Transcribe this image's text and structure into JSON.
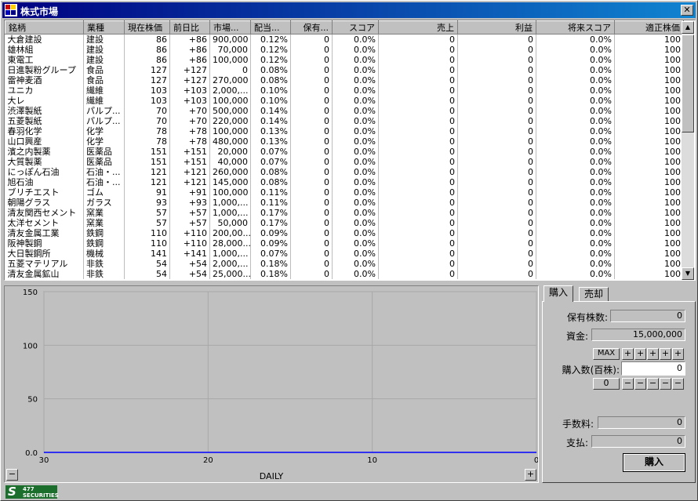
{
  "window": {
    "title": "株式市場",
    "close_label": "✕"
  },
  "table": {
    "columns": [
      "銘柄",
      "業種",
      "現在株価",
      "前日比",
      "市場...",
      "配当...",
      "保有...",
      "スコア",
      "売上",
      "利益",
      "将来スコア",
      "適正株価"
    ],
    "rows": [
      [
        "大倉建設",
        "建設",
        "86",
        "+86",
        "900,000",
        "0.12%",
        "0",
        "0.0%",
        "0",
        "0",
        "0.0%",
        "100"
      ],
      [
        "雄林組",
        "建設",
        "86",
        "+86",
        "70,000",
        "0.12%",
        "0",
        "0.0%",
        "0",
        "0",
        "0.0%",
        "100"
      ],
      [
        "東電工",
        "建設",
        "86",
        "+86",
        "100,000",
        "0.12%",
        "0",
        "0.0%",
        "0",
        "0",
        "0.0%",
        "100"
      ],
      [
        "日進製粉グループ",
        "食品",
        "127",
        "+127",
        "0",
        "0.08%",
        "0",
        "0.0%",
        "0",
        "0",
        "0.0%",
        "100"
      ],
      [
        "雷神麦酒",
        "食品",
        "127",
        "+127",
        "270,000",
        "0.08%",
        "0",
        "0.0%",
        "0",
        "0",
        "0.0%",
        "100"
      ],
      [
        "ユニカ",
        "繊維",
        "103",
        "+103",
        "2,000,...",
        "0.10%",
        "0",
        "0.0%",
        "0",
        "0",
        "0.0%",
        "100"
      ],
      [
        "大レ",
        "繊維",
        "103",
        "+103",
        "100,000",
        "0.10%",
        "0",
        "0.0%",
        "0",
        "0",
        "0.0%",
        "100"
      ],
      [
        "渋澤製紙",
        "パルプ...",
        "70",
        "+70",
        "500,000",
        "0.14%",
        "0",
        "0.0%",
        "0",
        "0",
        "0.0%",
        "100"
      ],
      [
        "五菱製紙",
        "パルプ...",
        "70",
        "+70",
        "220,000",
        "0.14%",
        "0",
        "0.0%",
        "0",
        "0",
        "0.0%",
        "100"
      ],
      [
        "春羽化学",
        "化学",
        "78",
        "+78",
        "100,000",
        "0.13%",
        "0",
        "0.0%",
        "0",
        "0",
        "0.0%",
        "100"
      ],
      [
        "山口興産",
        "化学",
        "78",
        "+78",
        "480,000",
        "0.13%",
        "0",
        "0.0%",
        "0",
        "0",
        "0.0%",
        "100"
      ],
      [
        "濱之内製薬",
        "医薬品",
        "151",
        "+151",
        "20,000",
        "0.07%",
        "0",
        "0.0%",
        "0",
        "0",
        "0.0%",
        "100"
      ],
      [
        "大質製薬",
        "医薬品",
        "151",
        "+151",
        "40,000",
        "0.07%",
        "0",
        "0.0%",
        "0",
        "0",
        "0.0%",
        "100"
      ],
      [
        "にっぽん石油",
        "石油・...",
        "121",
        "+121",
        "260,000",
        "0.08%",
        "0",
        "0.0%",
        "0",
        "0",
        "0.0%",
        "100"
      ],
      [
        "旭石油",
        "石油・...",
        "121",
        "+121",
        "145,000",
        "0.08%",
        "0",
        "0.0%",
        "0",
        "0",
        "0.0%",
        "100"
      ],
      [
        "ブリチエスト",
        "ゴム",
        "91",
        "+91",
        "100,000",
        "0.11%",
        "0",
        "0.0%",
        "0",
        "0",
        "0.0%",
        "100"
      ],
      [
        "朝陽グラス",
        "ガラス",
        "93",
        "+93",
        "1,000,...",
        "0.11%",
        "0",
        "0.0%",
        "0",
        "0",
        "0.0%",
        "100"
      ],
      [
        "清友関西セメント",
        "窯業",
        "57",
        "+57",
        "1,000,...",
        "0.17%",
        "0",
        "0.0%",
        "0",
        "0",
        "0.0%",
        "100"
      ],
      [
        "太洋セメント",
        "窯業",
        "57",
        "+57",
        "50,000",
        "0.17%",
        "0",
        "0.0%",
        "0",
        "0",
        "0.0%",
        "100"
      ],
      [
        "清友金属工業",
        "鉄鋼",
        "110",
        "+110",
        "200,00...",
        "0.09%",
        "0",
        "0.0%",
        "0",
        "0",
        "0.0%",
        "100"
      ],
      [
        "阪神製鋼",
        "鉄鋼",
        "110",
        "+110",
        "28,000...",
        "0.09%",
        "0",
        "0.0%",
        "0",
        "0",
        "0.0%",
        "100"
      ],
      [
        "大日製鋼所",
        "機械",
        "141",
        "+141",
        "1,000,...",
        "0.07%",
        "0",
        "0.0%",
        "0",
        "0",
        "0.0%",
        "100"
      ],
      [
        "五菱マテリアル",
        "非鉄",
        "54",
        "+54",
        "2,000,...",
        "0.18%",
        "0",
        "0.0%",
        "0",
        "0",
        "0.0%",
        "100"
      ],
      [
        "清友金属鉱山",
        "非鉄",
        "54",
        "+54",
        "25,000...",
        "0.18%",
        "0",
        "0.0%",
        "0",
        "0",
        "0.0%",
        "100"
      ]
    ]
  },
  "chart": {
    "period_label": "DAILY",
    "zoom_out_label": "−",
    "zoom_in_label": "+",
    "line_color": "#0000ff"
  },
  "chart_data": {
    "type": "line",
    "x": [
      30,
      29,
      28,
      27,
      26,
      25,
      24,
      23,
      22,
      21,
      20,
      19,
      18,
      17,
      16,
      15,
      14,
      13,
      12,
      11,
      10,
      9,
      8,
      7,
      6,
      5,
      4,
      3,
      2,
      1,
      0
    ],
    "series": [
      {
        "values": [
          0,
          0,
          0,
          0,
          0,
          0,
          0,
          0,
          0,
          0,
          0,
          0,
          0,
          0,
          0,
          0,
          0,
          0,
          0,
          0,
          0,
          0,
          0,
          0,
          0,
          0,
          0,
          0,
          0,
          0,
          0
        ]
      }
    ],
    "xlim": [
      30,
      0
    ],
    "ylim": [
      0,
      150
    ],
    "x_ticks": [
      "30",
      "20",
      "10",
      "0"
    ],
    "y_ticks": [
      "150",
      "100",
      "50",
      "0.0"
    ],
    "grid": true
  },
  "trade": {
    "tabs": [
      "購入",
      "売却"
    ],
    "holdings_label": "保有株数:",
    "holdings_value": "0",
    "funds_label": "資金:",
    "funds_value": "15,000,000",
    "max_label": "MAX",
    "plus": "+",
    "minus": "−",
    "qty_label": "購入数(百株):",
    "qty_value": "0",
    "zero_label": "0",
    "fee_label": "手数料:",
    "fee_value": "0",
    "pay_label": "支払:",
    "pay_value": "0",
    "buy_button": "購入"
  },
  "status": {
    "logo_line1": "477",
    "logo_line2": "SECURITIES"
  }
}
